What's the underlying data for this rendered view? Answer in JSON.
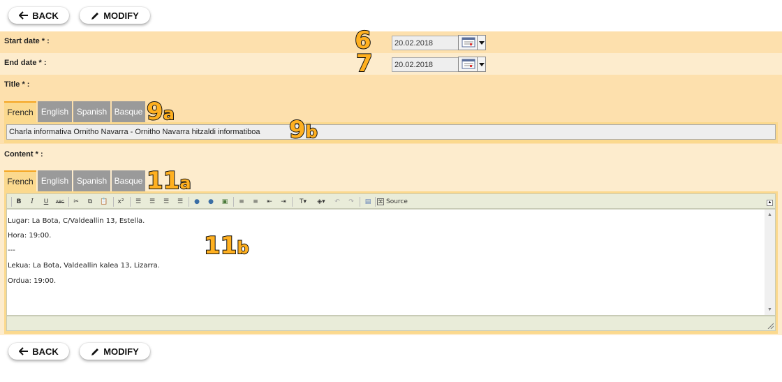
{
  "toolbar_top": {
    "back_label": "BACK",
    "modify_label": "MODIFY"
  },
  "toolbar_bottom": {
    "back_label": "BACK",
    "modify_label": "MODIFY"
  },
  "form": {
    "start_date": {
      "label": "Start date * :",
      "value": "20.02.2018",
      "annotation": "6"
    },
    "end_date": {
      "label": "End date * :",
      "value": "20.02.2018",
      "annotation": "7"
    },
    "title": {
      "label": "Title * :",
      "tabs": [
        "French",
        "English",
        "Spanish",
        "Basque"
      ],
      "active_tab": "French",
      "value": "Charla informativa Ornitho Navarra - Ornitho Navarra hitzaldi informatiboa",
      "annotation_tabs": "9",
      "annotation_tabs_suffix": "a",
      "annotation_input": "9",
      "annotation_input_suffix": "b"
    },
    "content": {
      "label": "Content * :",
      "tabs": [
        "French",
        "English",
        "Spanish",
        "Basque"
      ],
      "active_tab": "French",
      "annotation_tabs": "11",
      "annotation_tabs_suffix": "a",
      "annotation_editor": "11",
      "annotation_editor_suffix": "b",
      "editor_source_label": "Source",
      "lines": [
        "Lugar: La Bota, C/Valdeallin 13, Estella.",
        "Hora: 19:00.",
        "---",
        "Lekua: La Bota, Valdeallin kalea 13, Lizarra.",
        "Ordua: 19:00."
      ]
    }
  },
  "colors": {
    "row_dark": "#fde0ad",
    "row_light": "#fdeccd",
    "tab_active": "#fbd98e",
    "tab_inactive": "#9a9a9a",
    "annotation": "#ffb020"
  }
}
